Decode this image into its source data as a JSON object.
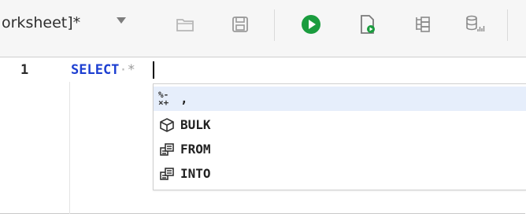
{
  "toolbar": {
    "tab_title": "orksheet]*",
    "icons": [
      "chevron-down-icon",
      "open-folder-icon",
      "save-icon",
      "run-icon",
      "run-script-icon",
      "explain-plan-icon",
      "autotrace-icon"
    ]
  },
  "editor": {
    "line_number": "1",
    "keyword": "SELECT",
    "dot": "·",
    "star": "*"
  },
  "autocomplete": {
    "items": [
      {
        "label": ",",
        "icon": "operators-icon",
        "ops_top": "%-",
        "ops_bottom": "×+",
        "selected": true
      },
      {
        "label": "BULK",
        "icon": "cube-icon",
        "selected": false
      },
      {
        "label": "FROM",
        "icon": "keyword-icon",
        "selected": false
      },
      {
        "label": "INTO",
        "icon": "keyword-icon",
        "selected": false
      }
    ]
  },
  "colors": {
    "keyword": "#1d3fd1",
    "run_green": "#1a9c3e",
    "selection": "#e6eefb"
  }
}
